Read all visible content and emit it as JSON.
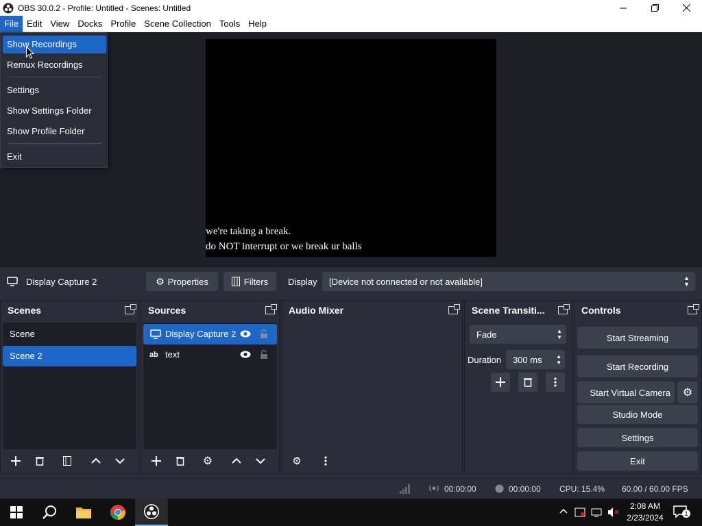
{
  "window": {
    "title": "OBS 30.0.2 - Profile: Untitled - Scenes: Untitled"
  },
  "menu": [
    {
      "label": "File",
      "active": true
    },
    {
      "label": "Edit"
    },
    {
      "label": "View"
    },
    {
      "label": "Docks"
    },
    {
      "label": "Profile"
    },
    {
      "label": "Scene Collection"
    },
    {
      "label": "Tools"
    },
    {
      "label": "Help"
    }
  ],
  "file_menu": {
    "show_recordings": "Show Recordings",
    "remux_recordings": "Remux Recordings",
    "settings": "Settings",
    "show_settings_folder": "Show Settings Folder",
    "show_profile_folder": "Show Profile Folder",
    "exit": "Exit"
  },
  "preview": {
    "line1": "we're taking a break.",
    "line2": "do NOT interrupt or we break ur balls"
  },
  "source_toolbar": {
    "selected_source": "Display Capture 2",
    "properties": "Properties",
    "filters": "Filters",
    "display_label": "Display",
    "display_value": "[Device not connected or not available]"
  },
  "scenes": {
    "title": "Scenes",
    "items": [
      "Scene",
      "Scene 2"
    ],
    "selected_index": 1
  },
  "sources": {
    "title": "Sources",
    "items": [
      {
        "label": "Display Capture 2",
        "icon": "monitor-icon"
      },
      {
        "label": "text",
        "icon": "text-icon"
      }
    ]
  },
  "audio_mixer": {
    "title": "Audio Mixer"
  },
  "transitions": {
    "title": "Scene Transiti...",
    "selected": "Fade",
    "duration_label": "Duration",
    "duration_value": "300 ms"
  },
  "controls": {
    "title": "Controls",
    "start_streaming": "Start Streaming",
    "start_recording": "Start Recording",
    "start_virtual_camera": "Start Virtual Camera",
    "studio_mode": "Studio Mode",
    "settings": "Settings",
    "exit": "Exit"
  },
  "status": {
    "stream_time": "00:00:00",
    "record_time": "00:00:00",
    "cpu": "CPU: 15.4%",
    "fps": "60.00 / 60.00 FPS"
  },
  "taskbar": {
    "time": "2:08 AM",
    "date": "2/23/2024",
    "notification_count": "1"
  },
  "colors": {
    "accent": "#1e66c8",
    "panel": "#2b2e38",
    "dark": "#1e1f26",
    "button": "#3c404b"
  }
}
